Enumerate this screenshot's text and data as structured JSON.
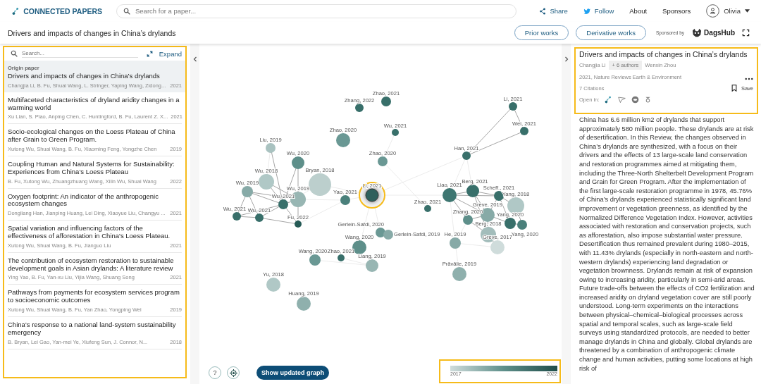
{
  "header": {
    "logo_text": "CONNECTED PAPERS",
    "search": {
      "placeholder": "Search for a paper..."
    },
    "nav": [
      {
        "label": "Share",
        "kind": "share"
      },
      {
        "label": "Follow",
        "kind": "follow"
      },
      {
        "label": "About",
        "kind": "plain"
      },
      {
        "label": "Sponsors",
        "kind": "plain"
      }
    ],
    "user": {
      "name": "Olivia"
    }
  },
  "toolbar": {
    "title": "Drivers and impacts of changes in China’s drylands",
    "buttons": [
      "Prior works",
      "Derivative works"
    ],
    "sponsor_label": "Sponsored by",
    "sponsor_name": "DagsHub"
  },
  "paper_list": {
    "search": {
      "placeholder": "Search..."
    },
    "expand": "Expand",
    "items": [
      {
        "kind": "origin",
        "label": "Origin paper",
        "title": "Drivers and impacts of changes in China’s drylands",
        "authors": "Changjia Li, B. Fu, Shuai Wang, L. Stringer, Yaping Wang, Zidong...",
        "year": "2021",
        "selected": true
      },
      {
        "kind": "paper",
        "title": "Multifaceted characteristics of dryland aridity changes in a warming world",
        "authors": "Xu Lian, S. Piao, Anping Chen, C. Huntingford, B. Fu, Laurent Z. X...",
        "year": "2021",
        "selected": false
      },
      {
        "kind": "paper",
        "title": "Socio-ecological changes on the Loess Plateau of China after Grain to Green Program.",
        "authors": "Xutong Wu, Shuai Wang, B. Fu, Xiaoming Feng, Yongzhe Chen",
        "year": "2019",
        "selected": false
      },
      {
        "kind": "paper",
        "title": "Coupling Human and Natural Systems for Sustainability: Experiences from China’s Loess Plateau",
        "authors": "B. Fu, Xutong Wu, Zhuangzhuang Wang, Xilin Wu, Shuai Wang",
        "year": "2022",
        "selected": false
      },
      {
        "kind": "paper",
        "title": "Oxygen footprint: An indicator of the anthropogenic ecosystem changes",
        "authors": "Dongliang Han, Jianping Huang, Lei Ding, Xiaoyue Liu, Changyu ...",
        "year": "2021",
        "selected": false
      },
      {
        "kind": "paper",
        "title": "Spatial variation and influencing factors of the effectiveness of afforestation in China's Loess Plateau.",
        "authors": "Xutong Wu, Shuai Wang, B. Fu, Jianguo Liu",
        "year": "2021",
        "selected": false
      },
      {
        "kind": "paper",
        "title": "The contribution of ecosystem restoration to sustainable development goals in Asian drylands: A literature review",
        "authors": "Ying Yao, B. Fu, Yan-xu Liu, Yijia Wang, Shuang Song",
        "year": "2021",
        "selected": false
      },
      {
        "kind": "paper",
        "title": "Pathways from payments for ecosystem services program to socioeconomic outcomes",
        "authors": "Xutong Wu, Shuai Wang, B. Fu, Yan Zhao, Yongping Wei",
        "year": "2019",
        "selected": false
      },
      {
        "kind": "paper",
        "title": "China’s response to a national land-system sustainability emergency",
        "authors": "B. Bryan, Lei Gao, Yan-mei Ye, Xiufeng Sun, J. Connor, N...",
        "year": "2018",
        "selected": false
      }
    ]
  },
  "graph": {
    "nodes": [
      {
        "label": "Zhang, 2022",
        "color": "#386f6a",
        "selected": false
      },
      {
        "label": "Zhao, 2021",
        "color": "#386f6a",
        "selected": false
      },
      {
        "label": "Zhao, 2020",
        "color": "#6a9894",
        "selected": false
      },
      {
        "label": "Liu, 2019",
        "color": "#a9c2c0",
        "selected": false
      },
      {
        "label": "Wu, 2020",
        "color": "#5e8f8a",
        "selected": false
      },
      {
        "label": "Wu, 2018",
        "color": "#b0c8c6",
        "selected": false
      },
      {
        "label": "Bryan, 2018",
        "color": "#bccfcd",
        "selected": false
      },
      {
        "label": "Wu, 2019",
        "color": "#87aaa7",
        "selected": false
      },
      {
        "label": "Wu, 2019",
        "color": "#98b6b3",
        "selected": false
      },
      {
        "label": "Wu, 2021",
        "color": "#386f6a",
        "selected": false
      },
      {
        "label": "Yao, 2021",
        "color": "#4a807b",
        "selected": false
      },
      {
        "label": "Li, 2021",
        "color": "#2f605c",
        "selected": true
      },
      {
        "label": "Wu, 2021",
        "color": "#386f6a",
        "selected": false
      },
      {
        "label": "Wu, 2021",
        "color": "#386f6a",
        "selected": false
      },
      {
        "label": "Fu, 2022",
        "color": "#255a55",
        "selected": false
      },
      {
        "label": "Wu, 2021",
        "color": "#386f6a",
        "selected": false
      },
      {
        "label": "Zhao, 2020",
        "color": "#6a9894",
        "selected": false
      },
      {
        "label": "Li, 2021",
        "color": "#386f6a",
        "selected": false
      },
      {
        "label": "Wei, 2021",
        "color": "#386f6a",
        "selected": false
      },
      {
        "label": "Han, 2021",
        "color": "#386f6a",
        "selected": false
      },
      {
        "label": "Zhao, 2021",
        "color": "#386f6a",
        "selected": false
      },
      {
        "label": "Liao, 2021",
        "color": "#3e7671",
        "selected": false
      },
      {
        "label": "Berg, 2021",
        "color": "#386f6a",
        "selected": false
      },
      {
        "label": "Scheff., 2021",
        "color": "#386f6a",
        "selected": false
      },
      {
        "label": "Yang, 2018",
        "color": "#b0c8c6",
        "selected": false
      },
      {
        "label": "Greve, 2019",
        "color": "#87aaa7",
        "selected": false
      },
      {
        "label": "Zhang, 2020",
        "color": "#5e8f8a",
        "selected": false
      },
      {
        "label": "Yang, 2020",
        "color": "#386f6a",
        "selected": false
      },
      {
        "label": "Yang, 2020",
        "color": "#4a807b",
        "selected": false
      },
      {
        "label": "Berg, 2018",
        "color": "#a3bdbb",
        "selected": false
      },
      {
        "label": "Greve, 2017",
        "color": "#cfdcdb",
        "selected": false
      },
      {
        "label": "He, 2019",
        "color": "#87aaa7",
        "selected": false
      },
      {
        "label": "Gerlein-Safdi, 2020",
        "color": "#6a9894",
        "selected": false
      },
      {
        "label": "Gerlein-Safdi, 2019",
        "color": "#87aaa7",
        "selected": false
      },
      {
        "label": "Wang, 2020",
        "color": "#5e8f8a",
        "selected": false
      },
      {
        "label": "Wang, 2020",
        "color": "#6a9894",
        "selected": false
      },
      {
        "label": "Zhao, 2021",
        "color": "#386f6a",
        "selected": false
      },
      {
        "label": "Liang, 2019",
        "color": "#98b6b3",
        "selected": false
      },
      {
        "label": "Prăvălie, 2019",
        "color": "#8fb0ad",
        "selected": false
      },
      {
        "label": "Yu, 2018",
        "color": "#b0c8c6",
        "selected": false
      },
      {
        "label": "Huang, 2019",
        "color": "#8fb0ad",
        "selected": false
      }
    ],
    "help_button": "?",
    "update_button": "Show updated graph",
    "legend": {
      "min_label": "2017",
      "max_label": "2022"
    }
  },
  "details": {
    "title": "Drivers and impacts of changes in China’s drylands",
    "first_author": "Changjia Li",
    "more_authors": "+ 6 authors",
    "last_author": "Wenxin Zhou",
    "venue": "2021, Nature Reviews Earth & Environment",
    "citations": "7 Citations",
    "save": "Save",
    "open_in": "Open in:",
    "abstract": "China has 6.6 million km2 of drylands that support approximately 580 million people. These drylands are at risk of desertification. In this Review, the changes observed in China’s drylands are synthesized, with a focus on their drivers and the effects of 13 large-scale land conservation and restoration programmes aimed at mitigating them, including the Three-North Shelterbelt Development Program and Grain for Green Program. After the implementation of the first large-scale restoration programme in 1978, 45.76% of China’s drylands experienced statistically significant land improvement or vegetation greenness, as identified by the Normalized Difference Vegetation Index. However, activities associated with restoration and conservation projects, such as afforestation, also impose substantial water pressure. Desertification thus remained prevalent during 1980–2015, with 11.43% drylands (especially in north-eastern and north-western drylands) experiencing land degradation or vegetation brownness. Drylands remain at risk of expansion owing to increasing aridity, particularly in semi-arid areas. Future trade-offs between the effects of CO2 fertilization and increased aridity on dryland vegetation cover are still poorly understood. Long-term experiments on the interactions between physical–chemical–biological processes across spatial and temporal scales, such as large-scale field surveys using standardized protocols, are needed to better manage drylands in China and globally. Global drylands are threatened by a combination of anthropogenic climate change and human activities, putting some locations at high risk of"
  }
}
